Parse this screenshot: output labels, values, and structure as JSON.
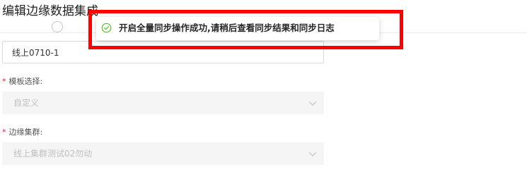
{
  "page": {
    "title": "编辑边缘数据集成"
  },
  "form": {
    "name_value": "线上0710-1",
    "template": {
      "required_mark": "*",
      "label": "模板选择:",
      "value": "自定义"
    },
    "cluster": {
      "required_mark": "*",
      "label": "边缘集群:",
      "value": "线上集群测试02勿动"
    }
  },
  "toast": {
    "icon": "check-circle-icon",
    "message": "开启全量同步操作成功,请稍后查看同步结果和同步日志",
    "color": "#52c41a"
  },
  "annotation": {
    "color": "#ff0000"
  }
}
